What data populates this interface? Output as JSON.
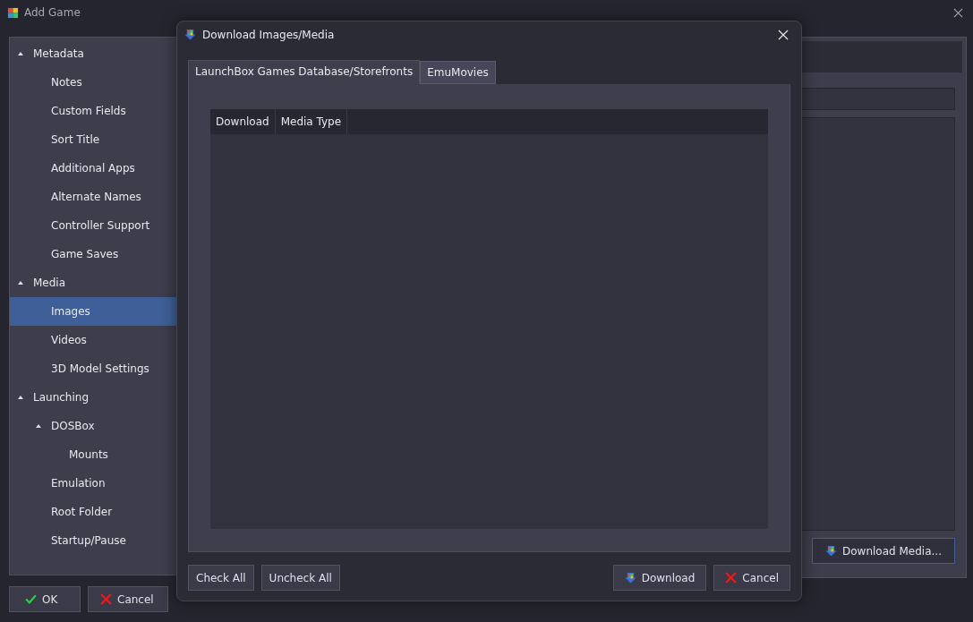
{
  "window": {
    "title": "Add Game"
  },
  "sidebar": {
    "items": [
      {
        "label": "Metadata",
        "expanded": true,
        "selected": false,
        "children": [
          {
            "label": "Notes",
            "selected": false
          },
          {
            "label": "Custom Fields",
            "selected": false
          },
          {
            "label": "Sort Title",
            "selected": false
          },
          {
            "label": "Additional Apps",
            "selected": false
          },
          {
            "label": "Alternate Names",
            "selected": false
          },
          {
            "label": "Controller Support",
            "selected": false
          },
          {
            "label": "Game Saves",
            "selected": false
          }
        ]
      },
      {
        "label": "Media",
        "expanded": true,
        "selected": false,
        "children": [
          {
            "label": "Images",
            "selected": true
          },
          {
            "label": "Videos",
            "selected": false
          },
          {
            "label": "3D Model Settings",
            "selected": false
          }
        ]
      },
      {
        "label": "Launching",
        "expanded": true,
        "selected": false,
        "children": [
          {
            "label": "DOSBox",
            "expanded": true,
            "selected": false,
            "children": [
              {
                "label": "Mounts",
                "selected": false
              }
            ]
          },
          {
            "label": "Emulation",
            "selected": false
          },
          {
            "label": "Root Folder",
            "selected": false
          },
          {
            "label": "Startup/Pause",
            "selected": false
          }
        ]
      }
    ]
  },
  "main_panel": {
    "download_button": "Download Media..."
  },
  "buttons": [
    {
      "label": "OK",
      "kind": "ok"
    },
    {
      "label": "Cancel",
      "kind": "cancel"
    }
  ],
  "dialog": {
    "title": "Download Images/Media",
    "tabs": [
      {
        "label": "LaunchBox Games Database/Storefronts",
        "selected": true
      },
      {
        "label": "EmuMovies",
        "selected": false
      }
    ],
    "table": {
      "columns": [
        "Download",
        "Media Type"
      ]
    },
    "left_buttons": [
      {
        "label": "Check All"
      },
      {
        "label": "Uncheck All"
      }
    ],
    "right_buttons": [
      {
        "label": "Download",
        "kind": "download"
      },
      {
        "label": "Cancel",
        "kind": "cancel"
      }
    ]
  }
}
